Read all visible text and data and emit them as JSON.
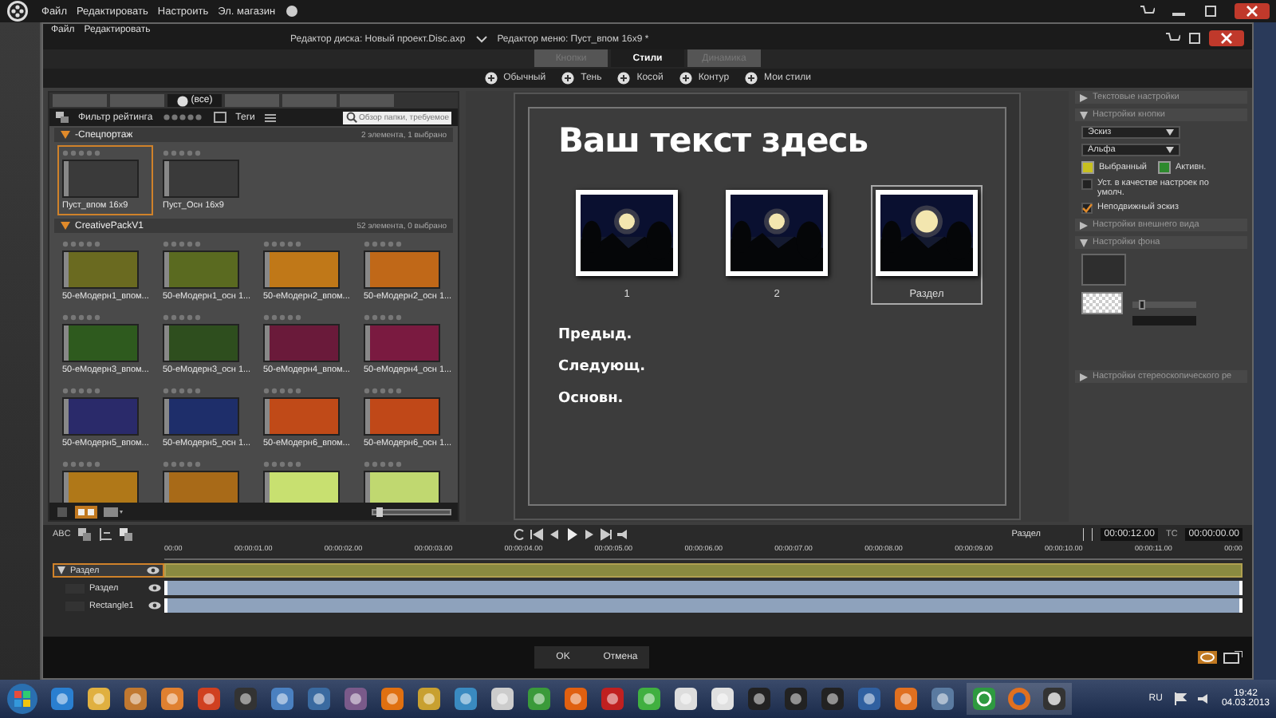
{
  "app": {
    "menu": [
      "Файл",
      "Редактировать",
      "Настроить",
      "Эл. магазин"
    ]
  },
  "dialog": {
    "menu": [
      "Файл",
      "Редактировать"
    ],
    "title": "Редактор диска: Новый проект.Disc.axp",
    "subtitle": "Редактор меню: Пуст_впом 16x9 *"
  },
  "tabs": [
    {
      "label": "Кнопки",
      "selected": false,
      "disabled": true
    },
    {
      "label": "Стили",
      "selected": true,
      "disabled": false
    },
    {
      "label": "Динамика",
      "selected": false,
      "disabled": true
    }
  ],
  "styles": [
    {
      "label": "Обычный"
    },
    {
      "label": "Тень"
    },
    {
      "label": "Косой"
    },
    {
      "label": "Контур"
    },
    {
      "label": "Мои стили"
    }
  ],
  "library": {
    "tabs": [
      {
        "selected": false
      },
      {
        "selected": false
      },
      {
        "label": "(все)",
        "selected": true
      },
      {
        "selected": false
      },
      {
        "selected": false
      },
      {
        "selected": false
      }
    ],
    "zoom": {
      "level": 0.05
    },
    "filter_label": "Фильтр рейтинга",
    "tags_label": "Теги",
    "search": {
      "placeholder": "Обзор папки, требуемое"
    },
    "groups": [
      {
        "name": "-Спецпортаж",
        "count": "2 элемента, 1 выбрано",
        "expanded": true,
        "items": [
          {
            "label": "Пуст_впом 16x9",
            "selected": true,
            "stars": 0,
            "color": "#3a3a3a"
          },
          {
            "label": "Пуст_Осн 16x9",
            "selected": false,
            "stars": 0,
            "color": "#3a3a3a"
          }
        ]
      },
      {
        "name": "CreativePackV1",
        "count": "52 элемента, 0 выбрано",
        "expanded": true,
        "items": [
          {
            "label": "50-eМодерн1_впом...",
            "selected": false,
            "stars": 0,
            "color": "#6a6a20"
          },
          {
            "label": "50-eМодерн1_осн 1...",
            "selected": false,
            "stars": 0,
            "color": "#5a6a20"
          },
          {
            "label": "50-eМодерн2_впом...",
            "selected": false,
            "stars": 0,
            "color": "#c07818"
          },
          {
            "label": "50-eМодерн2_осн 1...",
            "selected": false,
            "stars": 0,
            "color": "#c06818"
          },
          {
            "label": "50-eМодерн3_впом...",
            "selected": false,
            "stars": 0,
            "color": "#2e5a1e"
          },
          {
            "label": "50-eМодерн3_осн 1...",
            "selected": false,
            "stars": 0,
            "color": "#2e4e1e"
          },
          {
            "label": "50-eМодерн4_впом...",
            "selected": false,
            "stars": 0,
            "color": "#6a1a3a"
          },
          {
            "label": "50-eМодерн4_осн 1...",
            "selected": false,
            "stars": 0,
            "color": "#7a1a40"
          },
          {
            "label": "50-eМодерн5_впом...",
            "selected": false,
            "stars": 0,
            "color": "#2a2a6a"
          },
          {
            "label": "50-eМодерн5_осн 1...",
            "selected": false,
            "stars": 0,
            "color": "#1e2e6a"
          },
          {
            "label": "50-eМодерн6_впом...",
            "selected": false,
            "stars": 0,
            "color": "#c04a18"
          },
          {
            "label": "50-eМодерн6_осн 1...",
            "selected": false,
            "stars": 0,
            "color": "#c04818"
          },
          {
            "selected": false,
            "stars": 0,
            "color": "#b07818"
          },
          {
            "selected": false,
            "stars": 0,
            "color": "#a86a18"
          },
          {
            "selected": false,
            "stars": 0,
            "color": "#c8e070"
          },
          {
            "selected": false,
            "stars": 0,
            "color": "#c0d870"
          }
        ]
      }
    ]
  },
  "preview": {
    "heading": "Ваш текст здесь",
    "buttons": [
      {
        "label": "1",
        "selected": false
      },
      {
        "label": "2",
        "selected": false
      },
      {
        "label": "Раздел",
        "selected": true
      }
    ],
    "links": [
      "Предыд.",
      "Следующ.",
      "Основн."
    ]
  },
  "settings": [
    {
      "kind": "section",
      "label": "Текстовые настройки",
      "expanded": false
    },
    {
      "kind": "section",
      "label": "Настройки кнопки",
      "expanded": true
    },
    {
      "kind": "dropdown",
      "value": "Эскиз"
    },
    {
      "kind": "dropdown",
      "value": "Альфа"
    },
    {
      "kind": "swatches",
      "items": [
        {
          "label": "Выбранный",
          "color": "#c8c020"
        },
        {
          "label": "Активн.",
          "color": "#2e8a2e"
        }
      ]
    },
    {
      "kind": "checkbox",
      "label": "Уст. в качестве настроек по умолч.",
      "checked": false
    },
    {
      "kind": "checkbox",
      "label": "Неподвижный эскиз",
      "checked": true
    },
    {
      "kind": "section",
      "label": "Настройки внешнего вида",
      "expanded": false
    },
    {
      "kind": "section",
      "label": "Настройки фона",
      "expanded": true
    },
    {
      "kind": "background",
      "opacity": {
        "level": 0.1
      }
    },
    {
      "kind": "section",
      "label": "Настройки стереоскопического ре",
      "expanded": false
    }
  ],
  "timeline": {
    "chapter": "Раздел",
    "duration": "00:00:12.00",
    "tc_label": "TC",
    "timecode": "00:00:00.00",
    "abc": "ABC",
    "ticks": [
      "00:00",
      "00:00:01.00",
      "00:00:02.00",
      "00:00:03.00",
      "00:00:04.00",
      "00:00:05.00",
      "00:00:06.00",
      "00:00:07.00",
      "00:00:08.00",
      "00:00:09.00",
      "00:00:10.00",
      "00:00:11.00",
      "00:00"
    ],
    "tracks": [
      {
        "label": "Раздел",
        "kind": "group",
        "expanded": true,
        "color": "#8a8a40"
      },
      {
        "label": "Раздел",
        "kind": "layer",
        "color": "#8ea2bc"
      },
      {
        "label": "Rectangle1",
        "kind": "layer",
        "color": "#8ea2bc"
      }
    ]
  },
  "footer": [
    "OK",
    "Отмена"
  ],
  "tray": {
    "lang": "RU",
    "time": "19:42",
    "date": "04.03.2013"
  }
}
